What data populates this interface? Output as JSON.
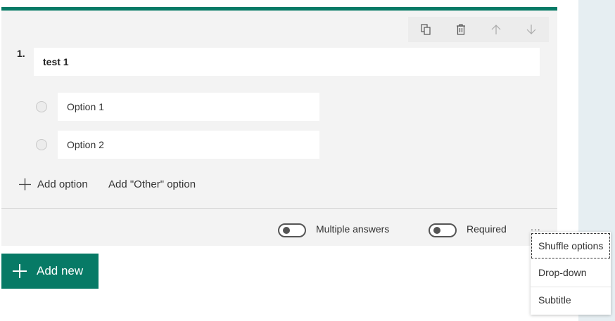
{
  "question": {
    "number": "1.",
    "title": "test 1",
    "options": [
      {
        "label": "Option 1"
      },
      {
        "label": "Option 2"
      }
    ],
    "add_option_label": "Add option",
    "add_other_label": "Add \"Other\" option"
  },
  "toolbar": {
    "icons": [
      "copy-icon",
      "delete-icon",
      "move-up-icon",
      "move-down-icon"
    ]
  },
  "footer": {
    "multiple_answers_label": "Multiple answers",
    "multiple_answers_on": false,
    "required_label": "Required",
    "required_on": false,
    "more_label": "..."
  },
  "add_new_label": "Add new",
  "menu": {
    "items": [
      {
        "label": "Shuffle options"
      },
      {
        "label": "Drop-down"
      },
      {
        "label": "Subtitle"
      }
    ]
  },
  "colors": {
    "accent": "#077a66",
    "card_bg": "#f3f3f3",
    "rail_bg": "#e6eef2"
  }
}
